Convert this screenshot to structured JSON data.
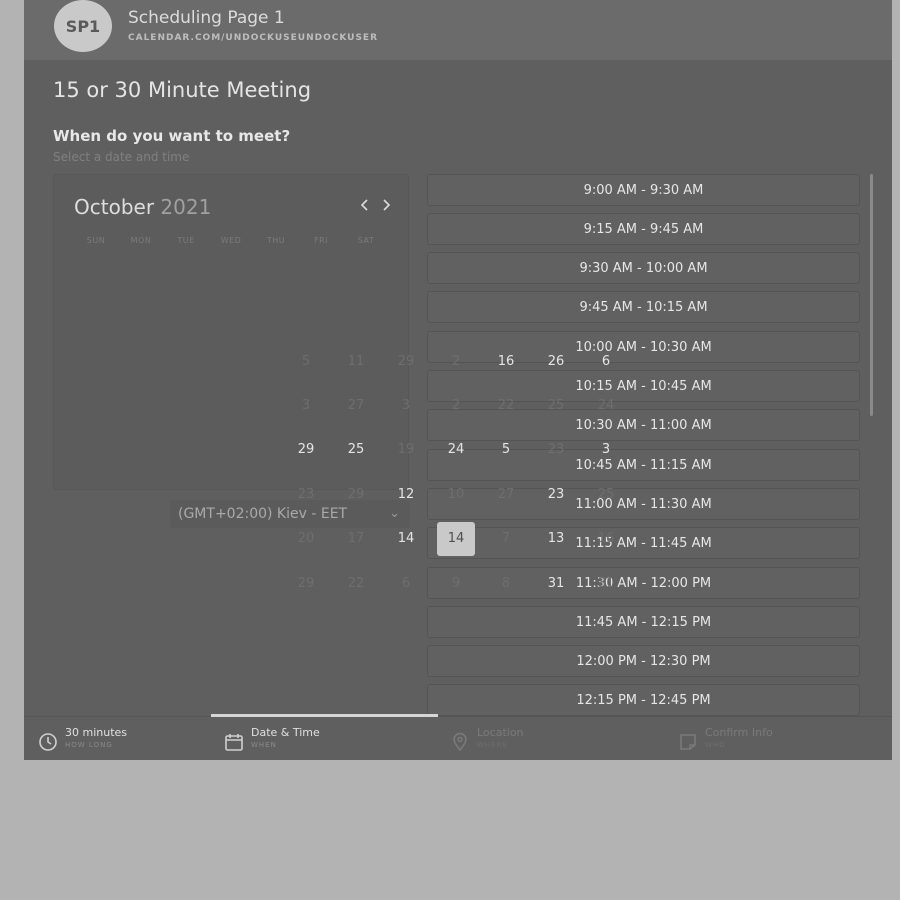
{
  "header": {
    "avatar": "SP1",
    "title": "Scheduling Page 1",
    "url": "CALENDAR.COM/UNDOCKUSEUNDOCKUSER"
  },
  "meeting": {
    "title": "15 or 30 Minute Meeting",
    "question": "When do you want to meet?",
    "subtitle": "Select a date and time"
  },
  "calendar": {
    "month": "October",
    "year": "2021",
    "weekdays": [
      "SUN",
      "MON",
      "TUE",
      "WED",
      "THU",
      "FRI",
      "SAT"
    ],
    "grid": [
      [
        "5",
        "11",
        "29",
        "2",
        "16",
        "26",
        "6"
      ],
      [
        "3",
        "27",
        "3",
        "2",
        "22",
        "25",
        "24"
      ],
      [
        "29",
        "25",
        "19",
        "24",
        "5",
        "23",
        "3"
      ],
      [
        "23",
        "29",
        "12",
        "10",
        "27",
        "23",
        "25"
      ],
      [
        "20",
        "17",
        "14",
        "14",
        "7",
        "13",
        "16"
      ],
      [
        "29",
        "22",
        "6",
        "9",
        "8",
        "31",
        "31"
      ]
    ],
    "selected_day": "14"
  },
  "timezone": {
    "value": "(GMT+02:00) Kiev - EET"
  },
  "time_slots": [
    "9:00 AM - 9:30 AM",
    "9:15 AM - 9:45 AM",
    "9:30 AM - 10:00 AM",
    "9:45 AM - 10:15 AM",
    "10:00 AM - 10:30 AM",
    "10:15 AM - 10:45 AM",
    "10:30 AM - 11:00 AM",
    "10:45 AM - 11:15 AM",
    "11:00 AM - 11:30 AM",
    "11:15 AM - 11:45 AM",
    "11:30 AM - 12:00 PM",
    "11:45 AM - 12:15 PM",
    "12:00 PM - 12:30 PM",
    "12:15 PM - 12:45 PM"
  ],
  "footer_steps": [
    {
      "label": "30 minutes",
      "sub": "HOW LONG",
      "icon": "clock-icon",
      "state": "done"
    },
    {
      "label": "Date & Time",
      "sub": "WHEN",
      "icon": "calendar-icon",
      "state": "active"
    },
    {
      "label": "Location",
      "sub": "WHERE",
      "icon": "location-pin-icon",
      "state": "pending"
    },
    {
      "label": "Confirm Info",
      "sub": "WHO",
      "icon": "confirm-note-icon",
      "state": "pending"
    }
  ],
  "colors": {
    "panel": "#5f5f5f",
    "page": "#b3b3b3",
    "selected_day": "#c9c9c9",
    "progress": "#d6d6d6"
  }
}
